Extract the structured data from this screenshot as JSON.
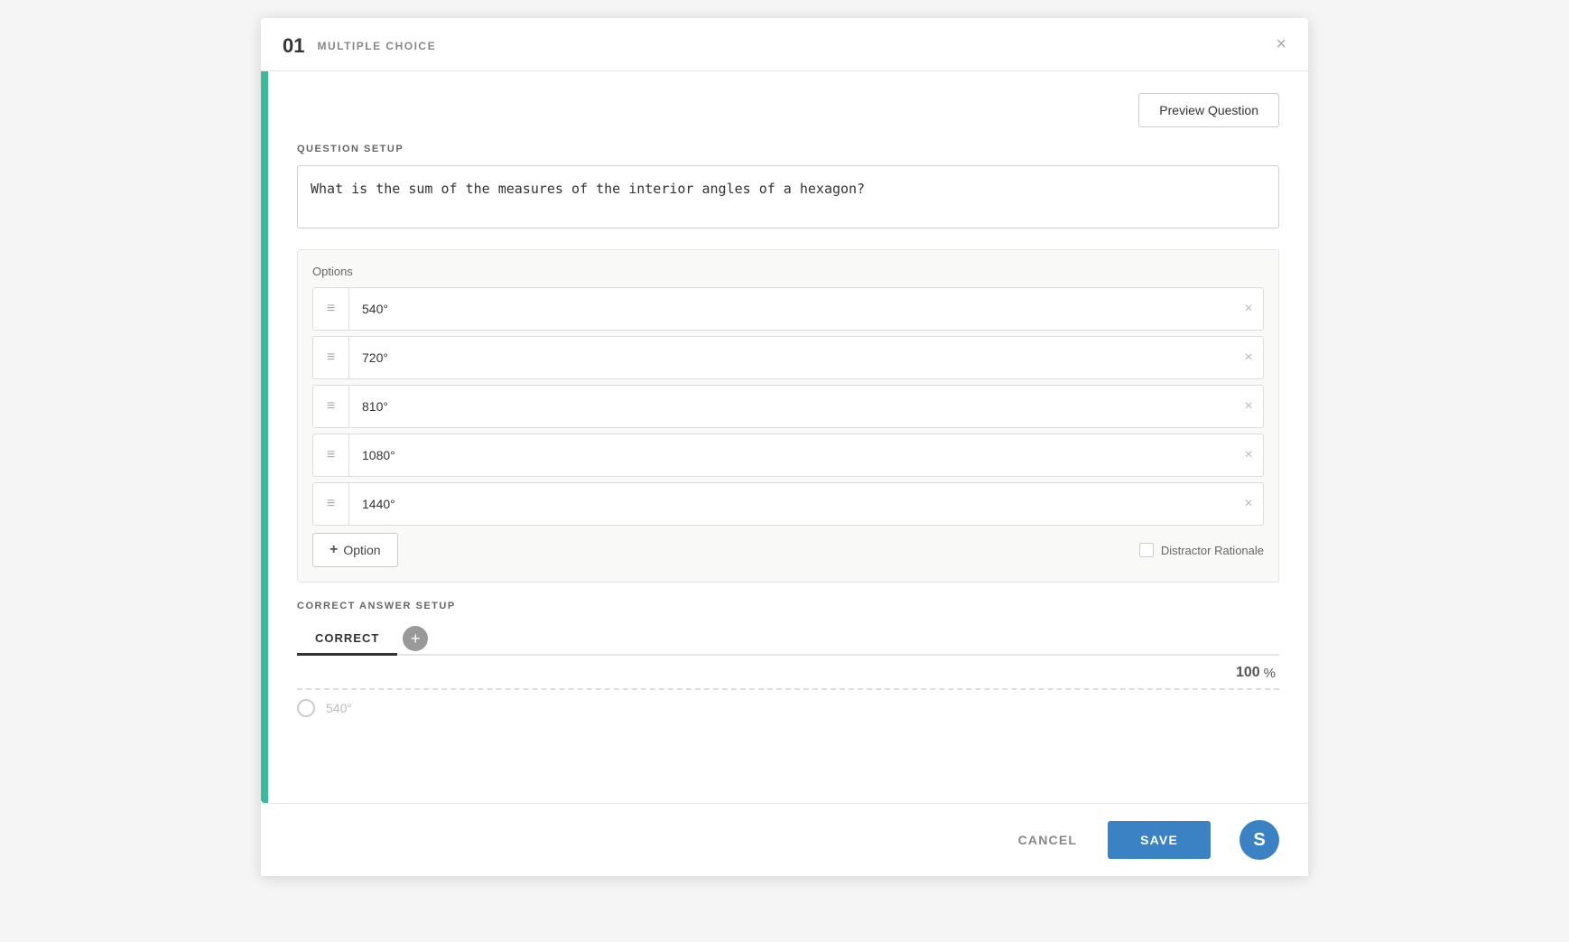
{
  "header": {
    "question_number": "01",
    "question_type": "MULTIPLE CHOICE",
    "close_icon": "×"
  },
  "preview_btn": "Preview Question",
  "question_setup": {
    "label": "QUESTION SETUP",
    "question_text": "What is the sum of the measures of the interior angles of a hexagon?",
    "options_label": "Options",
    "options": [
      {
        "id": 1,
        "value": "540°"
      },
      {
        "id": 2,
        "value": "720°"
      },
      {
        "id": 3,
        "value": "810°"
      },
      {
        "id": 4,
        "value": "1080°"
      },
      {
        "id": 5,
        "value": "1440°"
      }
    ],
    "add_option_label": "Option",
    "distractor_label": "Distractor Rationale"
  },
  "correct_answer": {
    "label": "CORRECT ANSWER SETUP",
    "tab_correct": "CORRECT",
    "percent_value": "100",
    "percent_symbol": "%"
  },
  "footer": {
    "cancel_label": "CANCEL",
    "save_label": "SAVE",
    "avatar_letter": "S"
  }
}
